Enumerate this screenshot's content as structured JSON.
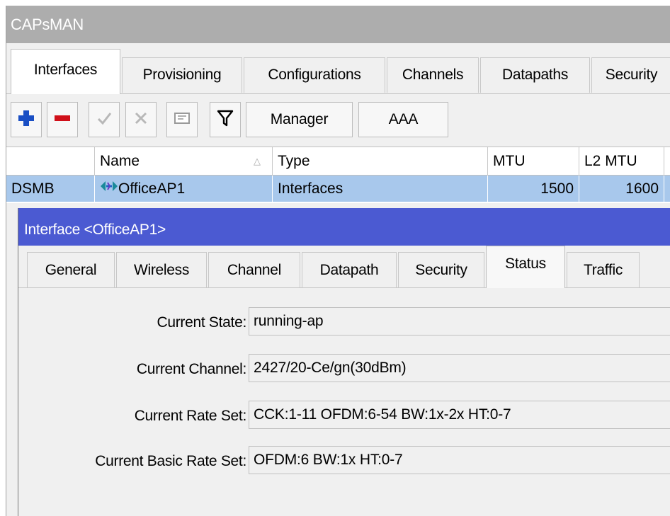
{
  "window": {
    "title": "CAPsMAN"
  },
  "tabs": [
    {
      "label": "Interfaces"
    },
    {
      "label": "Provisioning"
    },
    {
      "label": "Configurations"
    },
    {
      "label": "Channels"
    },
    {
      "label": "Datapaths"
    },
    {
      "label": "Security"
    }
  ],
  "toolbar": {
    "add_icon": "plus-icon",
    "remove_icon": "minus-icon",
    "enable_icon": "check-icon",
    "disable_icon": "cross-icon",
    "comment_icon": "comment-icon",
    "filter_icon": "filter-icon",
    "manager_label": "Manager",
    "aaa_label": "AAA"
  },
  "table": {
    "columns": [
      {
        "label": ""
      },
      {
        "label": "Name"
      },
      {
        "label": "Type"
      },
      {
        "label": "MTU"
      },
      {
        "label": "L2 MTU"
      }
    ],
    "rows": [
      {
        "flags": "DSMB",
        "name": "OfficeAP1",
        "type": "Interfaces",
        "mtu": "1500",
        "l2mtu": "1600"
      }
    ]
  },
  "dialog": {
    "title": "Interface <OfficeAP1>",
    "tabs": [
      {
        "label": "General"
      },
      {
        "label": "Wireless"
      },
      {
        "label": "Channel"
      },
      {
        "label": "Datapath"
      },
      {
        "label": "Security"
      },
      {
        "label": "Status"
      },
      {
        "label": "Traffic"
      }
    ],
    "fields": [
      {
        "label": "Current State:",
        "value": "running-ap"
      },
      {
        "label": "Current Channel:",
        "value": "2427/20-Ce/gn(30dBm)"
      },
      {
        "label": "Current Rate Set:",
        "value": "CCK:1-11 OFDM:6-54 BW:1x-2x HT:0-7"
      },
      {
        "label": "Current Basic Rate Set:",
        "value": "OFDM:6 BW:1x HT:0-7"
      }
    ]
  },
  "colors": {
    "title_bar": "#adadad",
    "dialog_title_bar": "#4b5ad2",
    "selected_row": "#a8c8ec",
    "add_icon": "#1a4fc4",
    "remove_icon": "#d0101a"
  }
}
